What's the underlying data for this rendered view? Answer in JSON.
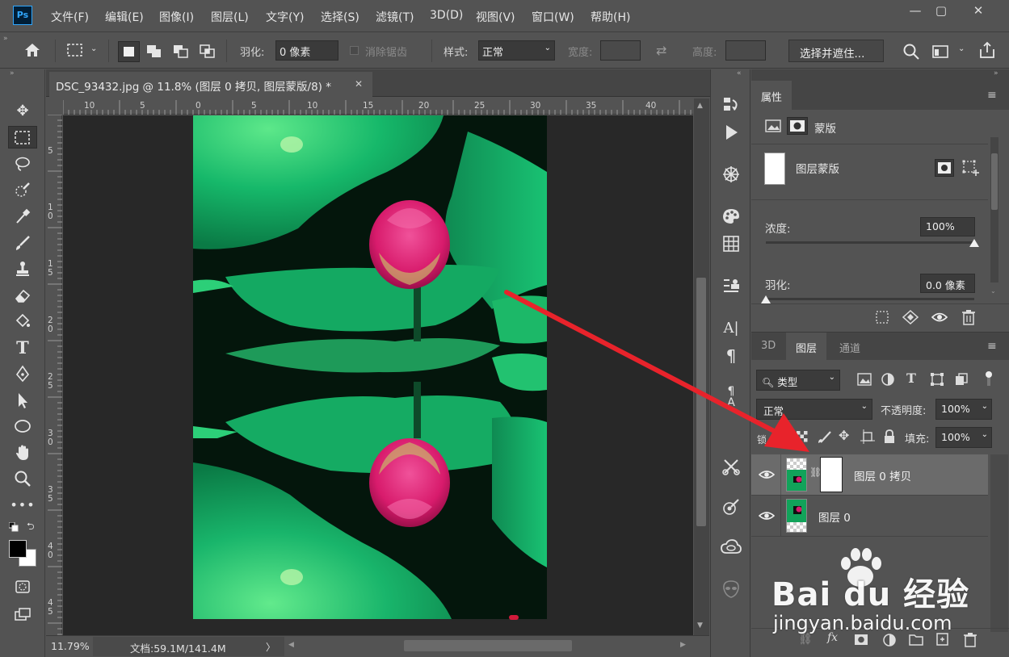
{
  "app": {
    "logo_text": "Ps"
  },
  "menu": [
    "文件(F)",
    "编辑(E)",
    "图像(I)",
    "图层(L)",
    "文字(Y)",
    "选择(S)",
    "滤镜(T)",
    "3D(D)",
    "视图(V)",
    "窗口(W)",
    "帮助(H)"
  ],
  "window_controls": {
    "minimize": "—",
    "restore": "▢",
    "close": "✕"
  },
  "options": {
    "feather_label": "羽化:",
    "feather_value": "0 像素",
    "antialias_label": "消除锯齿",
    "style_label": "样式:",
    "style_value": "正常",
    "width_label": "宽度:",
    "height_label": "高度:",
    "select_mask_button": "选择并遮住..."
  },
  "document": {
    "tab_title": "DSC_93432.jpg @ 11.8% (图层 0 拷贝, 图层蒙版/8) *",
    "close_glyph": "✕",
    "ruler_top": [
      "10",
      "5",
      "0",
      "5",
      "10",
      "15",
      "20",
      "25",
      "30",
      "35",
      "40"
    ],
    "ruler_left": [
      "5",
      "1 0",
      "1 5",
      "2 0",
      "2 5",
      "3 0",
      "3 5",
      "4 0",
      "4 5"
    ],
    "zoom": "11.79%",
    "doc_info": "文档:59.1M/141.4M",
    "status_arrow": "〉"
  },
  "properties": {
    "tab": "属性",
    "mask_type": "蒙版",
    "layer_mask_label": "图层蒙版",
    "density_label": "浓度:",
    "density_value": "100%",
    "density_fraction": 1.0,
    "feather_label": "羽化:",
    "feather_value": "0.0 像素",
    "feather_fraction": 0.0
  },
  "layers_panel": {
    "tabs": [
      "3D",
      "图层",
      "通道"
    ],
    "filter_label": "类型",
    "blend_mode": "正常",
    "opacity_label": "不透明度:",
    "opacity_value": "100%",
    "lock_label": "锁",
    "fill_label": "填充:",
    "fill_value": "100%",
    "layers": [
      {
        "name": "图层 0 拷贝",
        "selected": true,
        "has_mask": true
      },
      {
        "name": "图层 0",
        "selected": false,
        "has_mask": false
      }
    ],
    "footer_fx": "fx"
  },
  "watermark": {
    "brand": "Bai du 经验",
    "url": "jingyan.baidu.com"
  },
  "colors": {
    "accent_arrow": "#e8232b",
    "panel_bg": "#535353",
    "canvas_bg": "#282828",
    "selected_layer": "#6b6b6b"
  }
}
